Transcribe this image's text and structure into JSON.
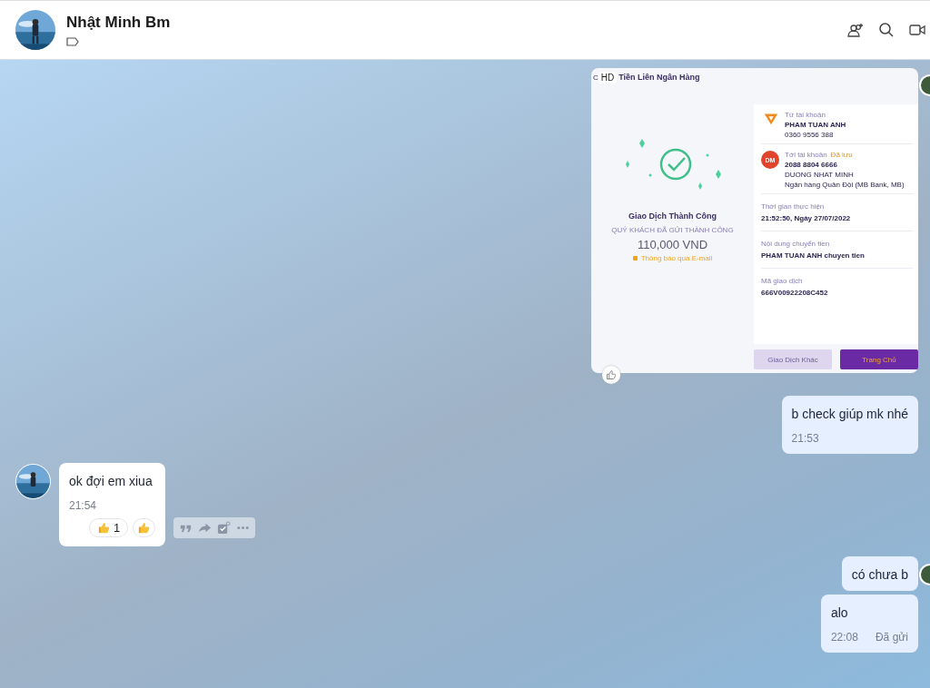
{
  "header": {
    "name": "Nhật Minh Bm"
  },
  "messages": [
    {
      "outgoing": true,
      "receipt": {
        "title_lead": "C",
        "badge": "HD",
        "title": "Tiền Liên Ngân Hàng",
        "status": "Giao Dịch Thành Công",
        "subtitle": "QUÝ KHÁCH ĐÃ GỬI THÀNH CÔNG",
        "amount": "110,000 VND",
        "email_note": "Thông báo qua E-mail",
        "sender": {
          "label": "Từ tài khoản",
          "name": "PHAM TUAN ANH",
          "account": "0360 9556 388"
        },
        "recipient": {
          "initials": "DM",
          "label": "Tới tài khoản",
          "saved": "Đã lưu",
          "account": "2088 8804 6666",
          "name": "DUONG NHAT MINH",
          "bank": "Ngân hàng Quân Đội (MB Bank, MB)"
        },
        "details": [
          {
            "label": "Thời gian thực hiện",
            "value": "21:52:50, Ngày 27/07/2022"
          },
          {
            "label": "Nội dung chuyển tiền",
            "value": "PHAM TUAN ANH chuyen tien"
          },
          {
            "label": "Mã giao dịch",
            "value": "666V00922208C452"
          }
        ],
        "buttons": [
          {
            "label": "Giao Dịch Khác",
            "primary": false
          },
          {
            "label": "Trang Chủ",
            "primary": true
          }
        ]
      }
    },
    {
      "kind": "text",
      "outgoing": true,
      "text": "b check giúp mk nhé",
      "time": "21:53"
    },
    {
      "kind": "text",
      "outgoing": false,
      "text": "ok đợi em xiua",
      "time": "21:54",
      "reaction_count": "1"
    },
    {
      "kind": "text",
      "outgoing": true,
      "text": "có chưa b"
    },
    {
      "kind": "text",
      "outgoing": true,
      "text": "alo",
      "time": "22:08",
      "status": "Đã gửi"
    }
  ]
}
